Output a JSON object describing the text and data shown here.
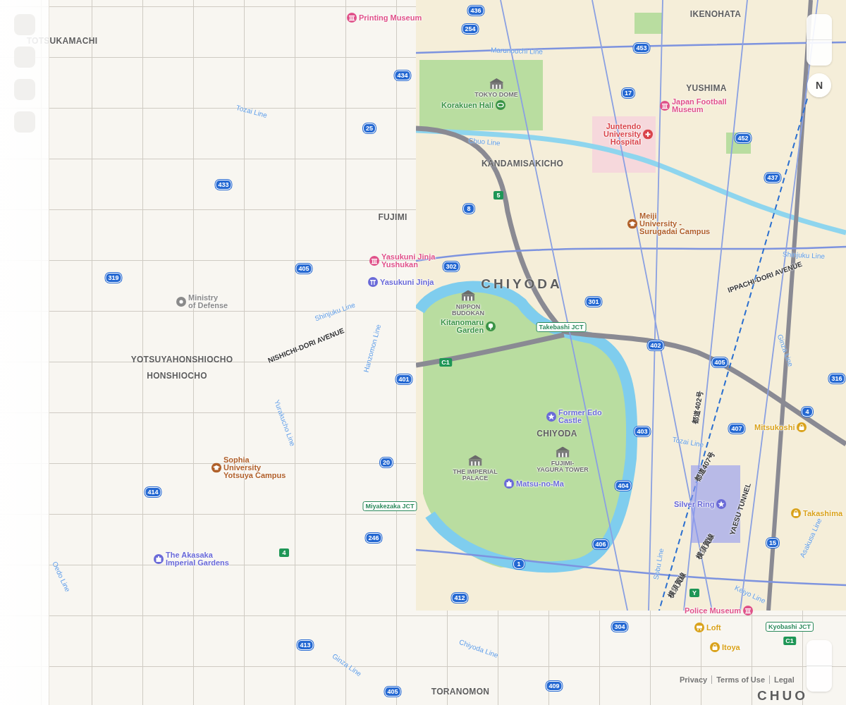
{
  "districts": [
    {
      "name": "TOTSUKAMACHI",
      "kind": "area"
    },
    {
      "name": "FUJIMI",
      "kind": "area"
    },
    {
      "name": "YOTSUYAHONSHIOCHO",
      "kind": "area"
    },
    {
      "name": "HONSHIOCHO",
      "kind": "area"
    },
    {
      "name": "IKENOHATA",
      "kind": "area"
    },
    {
      "name": "YUSHIMA",
      "kind": "area"
    },
    {
      "name": "KANDAMISAKICHO",
      "kind": "area"
    },
    {
      "name": "CHIYODA",
      "kind": "ward"
    },
    {
      "name": "CHIYODA",
      "kind": "area"
    },
    {
      "name": "TORANOMON",
      "kind": "area"
    },
    {
      "name": "CHUO",
      "kind": "ward"
    }
  ],
  "places": [
    {
      "name": "Printing Museum",
      "kind": "museum",
      "color": "#e0528a"
    },
    {
      "name": "Ministry\nof Defense",
      "kind": "government",
      "color": "#8a8a8a"
    },
    {
      "name": "Yasukuni Jinja\nYushukan",
      "kind": "museum",
      "color": "#e0528a"
    },
    {
      "name": "Yasukuni Jinja",
      "kind": "shrine",
      "color": "#6a6ad8"
    },
    {
      "name": "Sophia\nUniversity\nYotsuya Campus",
      "kind": "university",
      "color": "#b0602a"
    },
    {
      "name": "The Akasaka\nImperial Gardens",
      "kind": "palace",
      "color": "#6a6ad8"
    },
    {
      "name": "TOKYO DOME",
      "kind": "landmark",
      "color": "#6b6b6b"
    },
    {
      "name": "Korakuen Hall",
      "kind": "arena",
      "color": "#3a9346"
    },
    {
      "name": "Japan Football\nMuseum",
      "kind": "museum",
      "color": "#e0528a"
    },
    {
      "name": "Juntendo\nUniversity\nHospital",
      "kind": "hospital",
      "color": "#d9434a"
    },
    {
      "name": "Meiji\nUniversity -\nSurugadai Campus",
      "kind": "university",
      "color": "#b0602a"
    },
    {
      "name": "NIPPON\nBUDOKAN",
      "kind": "landmark",
      "color": "#6b6b6b"
    },
    {
      "name": "Kitanomaru\nGarden",
      "kind": "garden",
      "color": "#3a9346"
    },
    {
      "name": "Former Edo\nCastle",
      "kind": "star",
      "color": "#6a6ad8"
    },
    {
      "name": "FUJIMI-\nYAGURA TOWER",
      "kind": "landmark",
      "color": "#6b6b6b"
    },
    {
      "name": "THE IMPERIAL\nPALACE",
      "kind": "landmark",
      "color": "#6b6b6b"
    },
    {
      "name": "Matsu-no-Ma",
      "kind": "palace",
      "color": "#6a6ad8"
    },
    {
      "name": "Silver Ring",
      "kind": "star",
      "color": "#6a6ad8"
    },
    {
      "name": "Mitsukoshi",
      "kind": "store",
      "color": "#d9a21b"
    },
    {
      "name": "Takashima",
      "kind": "store",
      "color": "#d9a21b"
    },
    {
      "name": "Police Museum",
      "kind": "museum",
      "color": "#e0528a"
    },
    {
      "name": "Loft",
      "kind": "shop",
      "color": "#d9a21b"
    },
    {
      "name": "Itoya",
      "kind": "store",
      "color": "#d9a21b"
    }
  ],
  "transit_lines": [
    {
      "name": "Tozai Line"
    },
    {
      "name": "Marunouchi Line"
    },
    {
      "name": "Chuo Line"
    },
    {
      "name": "Shinjuku Line"
    },
    {
      "name": "Hanzomon Line"
    },
    {
      "name": "Yurakucho Line"
    },
    {
      "name": "Oedo Line"
    },
    {
      "name": "Ginza Line"
    },
    {
      "name": "Chiyoda Line"
    },
    {
      "name": "Shinjuku Line"
    },
    {
      "name": "Ginza Line"
    },
    {
      "name": "Tozai Line"
    },
    {
      "name": "Sobu Line"
    },
    {
      "name": "Keiyo Line"
    },
    {
      "name": "Asakusa Line"
    }
  ],
  "streets": [
    {
      "name": "NISHICHI-DORI AVENUE"
    },
    {
      "name": "IPPACHI-DORI AVENUE"
    },
    {
      "name": "YAESU TUNNEL"
    },
    {
      "name": "都道402号"
    },
    {
      "name": "都道407号"
    },
    {
      "name": "横須賀線"
    },
    {
      "name": "横須賀線"
    }
  ],
  "route_shields": [
    {
      "number": "436",
      "kind": "national"
    },
    {
      "number": "254",
      "kind": "national"
    },
    {
      "number": "453",
      "kind": "national"
    },
    {
      "number": "434",
      "kind": "national"
    },
    {
      "number": "17",
      "kind": "national"
    },
    {
      "number": "25",
      "kind": "national"
    },
    {
      "number": "452",
      "kind": "national"
    },
    {
      "number": "437",
      "kind": "national"
    },
    {
      "number": "433",
      "kind": "national"
    },
    {
      "number": "8",
      "kind": "national"
    },
    {
      "number": "302",
      "kind": "national"
    },
    {
      "number": "405",
      "kind": "national"
    },
    {
      "number": "319",
      "kind": "national"
    },
    {
      "number": "301",
      "kind": "national"
    },
    {
      "number": "402",
      "kind": "national"
    },
    {
      "number": "401",
      "kind": "national"
    },
    {
      "number": "405",
      "kind": "national"
    },
    {
      "number": "316",
      "kind": "national"
    },
    {
      "number": "4",
      "kind": "national"
    },
    {
      "number": "403",
      "kind": "national"
    },
    {
      "number": "407",
      "kind": "national"
    },
    {
      "number": "20",
      "kind": "national"
    },
    {
      "number": "404",
      "kind": "national"
    },
    {
      "number": "414",
      "kind": "national"
    },
    {
      "number": "246",
      "kind": "national"
    },
    {
      "number": "406",
      "kind": "national"
    },
    {
      "number": "15",
      "kind": "national"
    },
    {
      "number": "1",
      "kind": "national"
    },
    {
      "number": "412",
      "kind": "national"
    },
    {
      "number": "304",
      "kind": "national"
    },
    {
      "number": "413",
      "kind": "national"
    },
    {
      "number": "405",
      "kind": "national"
    },
    {
      "number": "409",
      "kind": "national"
    },
    {
      "number": "5",
      "kind": "expressway"
    },
    {
      "number": "C1",
      "kind": "expressway"
    },
    {
      "number": "4",
      "kind": "expressway"
    },
    {
      "number": "Y",
      "kind": "expressway"
    },
    {
      "number": "C1",
      "kind": "expressway"
    }
  ],
  "junctions": [
    {
      "name": "Takebashi JCT"
    },
    {
      "name": "Miyakezaka JCT"
    },
    {
      "name": "Kyobashi JCT"
    }
  ],
  "compass": {
    "label": "N"
  },
  "footer_links": [
    "Privacy",
    "Terms of Use",
    "Legal"
  ]
}
